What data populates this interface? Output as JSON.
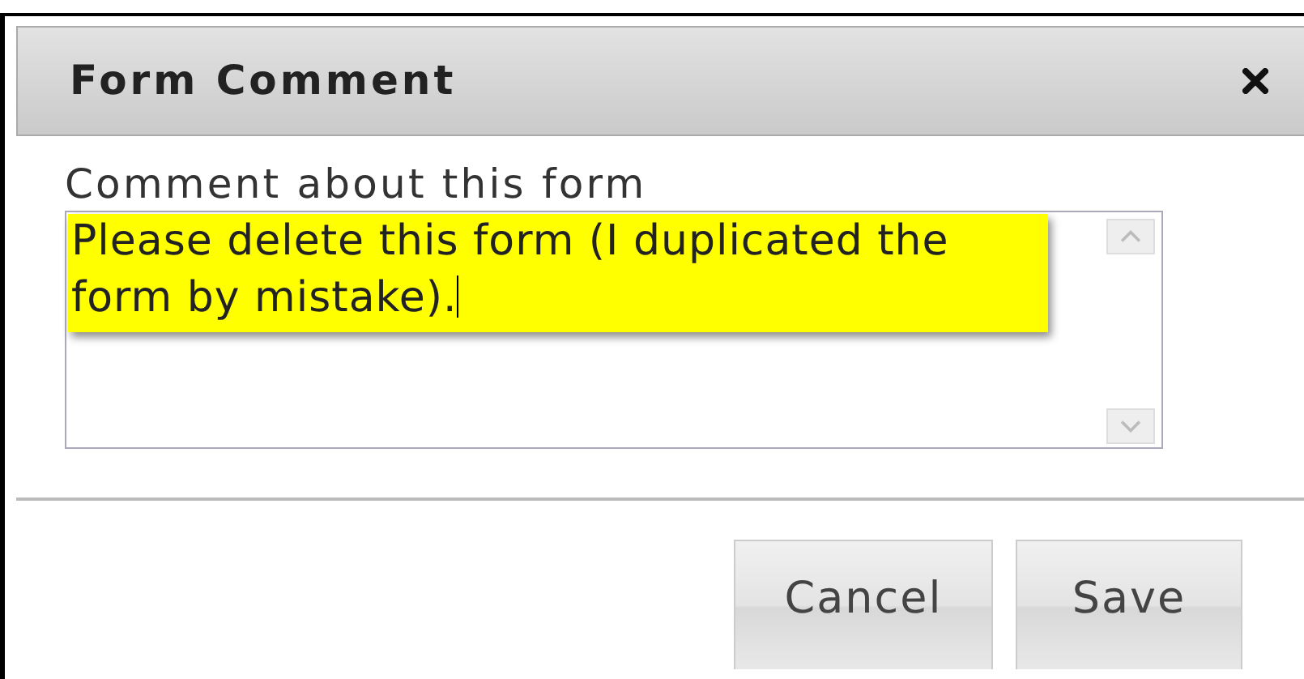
{
  "dialog": {
    "title": "Form Comment"
  },
  "field": {
    "label": "Comment about this form",
    "value": "Please delete this form (I duplicated the form by mistake).",
    "highlighted": true,
    "focused": true
  },
  "buttons": [
    "Cancel",
    "Save"
  ]
}
